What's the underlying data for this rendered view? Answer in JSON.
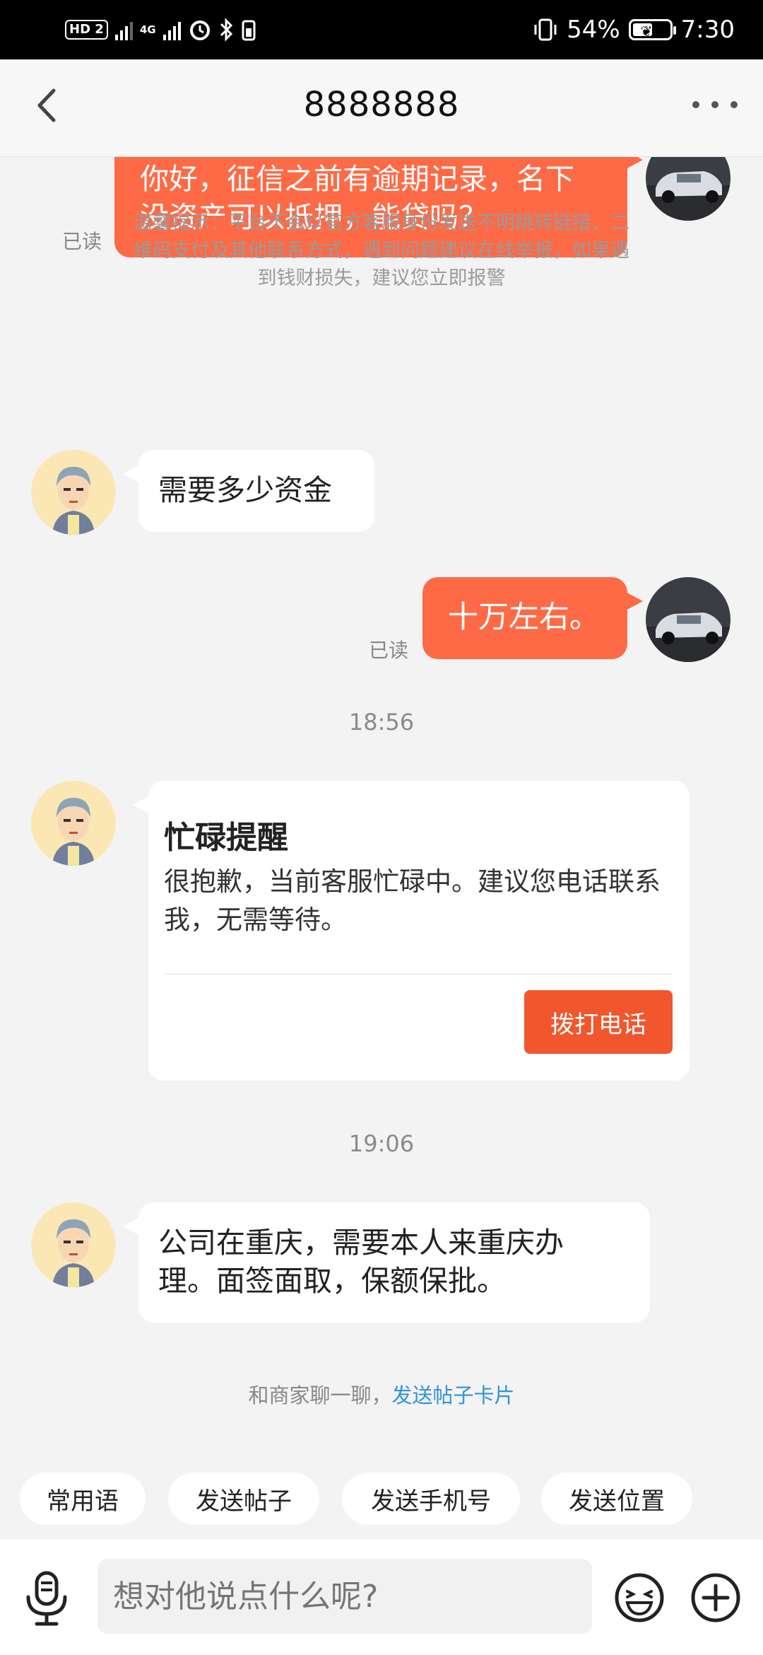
{
  "status_bar": {
    "hd": "HD",
    "sim": "2",
    "network": "4G",
    "battery": "54%",
    "battery_level": 0.54,
    "time": "7:30"
  },
  "header": {
    "title": "8888888"
  },
  "messages": {
    "m1_text": "你好，征信之前有逾期记录，名下没资产可以抵押，能贷吗？",
    "m1_status": "已读",
    "notice": "温馨提示：平台不会以官方客服身份发送不明跳转链接、二维码支付及其他联系方式，遇到问题建议在线举报，如果遇到钱财损失，建议您立即报警",
    "m2_text": "需要多少资金",
    "m3_text": "十万左右。",
    "m3_status": "已读",
    "time1": "18:56",
    "card_title": "忙碌提醒",
    "card_body": "很抱歉，当前客服忙碌中。建议您电话联系我，无需等待。",
    "card_button": "拨打电话",
    "time2": "19:06",
    "m4_text": "公司在重庆，需要本人来重庆办理。面签面取，保额保批。"
  },
  "hint": {
    "prefix": "和商家聊一聊，",
    "link": "发送帖子卡片"
  },
  "quick_replies": [
    "常用语",
    "发送帖子",
    "发送手机号",
    "发送位置"
  ],
  "input": {
    "placeholder": "想对他说点什么呢?"
  },
  "colors": {
    "accent": "#fe6a46",
    "button": "#f2562c",
    "link": "#2f94d8"
  },
  "icons": [
    "back-icon",
    "more-icon",
    "voice-icon",
    "emoji-icon",
    "plus-icon"
  ]
}
